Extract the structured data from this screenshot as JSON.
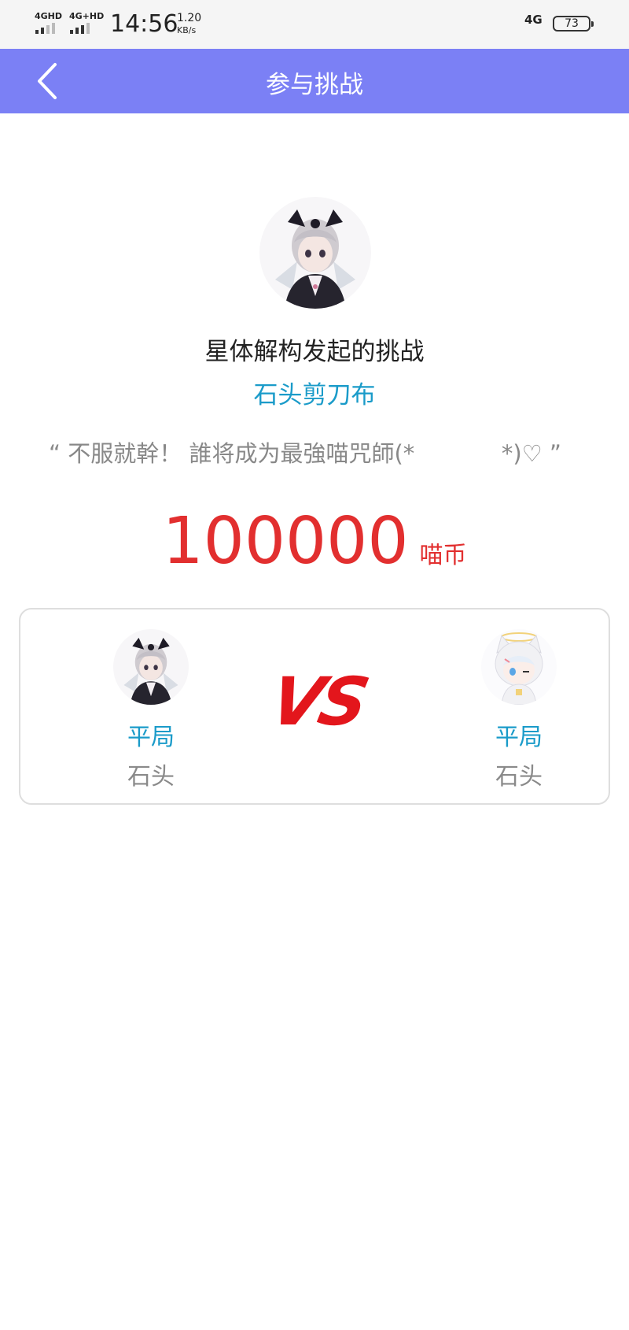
{
  "status_bar": {
    "signal_1_label": "4GHD",
    "signal_2_label": "4G+HD",
    "time": "14:56",
    "speed_value": "1.20",
    "speed_unit": "KB/s",
    "network_right": "4G",
    "battery": "73"
  },
  "nav": {
    "title": "参与挑战",
    "back_icon": "chevron-left-icon"
  },
  "challenge": {
    "creator_line": "星体解构发起的挑战",
    "game_type": "石头剪刀布",
    "motto": "“ 不服就幹！ 誰将成为最強喵咒師(*            *)♡ ”",
    "stake_amount": "100000",
    "stake_unit": "喵币"
  },
  "duel": {
    "vs_label": "VS",
    "left": {
      "result": "平局",
      "move": "石头"
    },
    "right": {
      "result": "平局",
      "move": "石头"
    }
  },
  "colors": {
    "nav_background": "#7b80f5",
    "accent_blue": "#1a9bc9",
    "stake_red": "#e22f2f",
    "vs_red": "#e3161c"
  }
}
